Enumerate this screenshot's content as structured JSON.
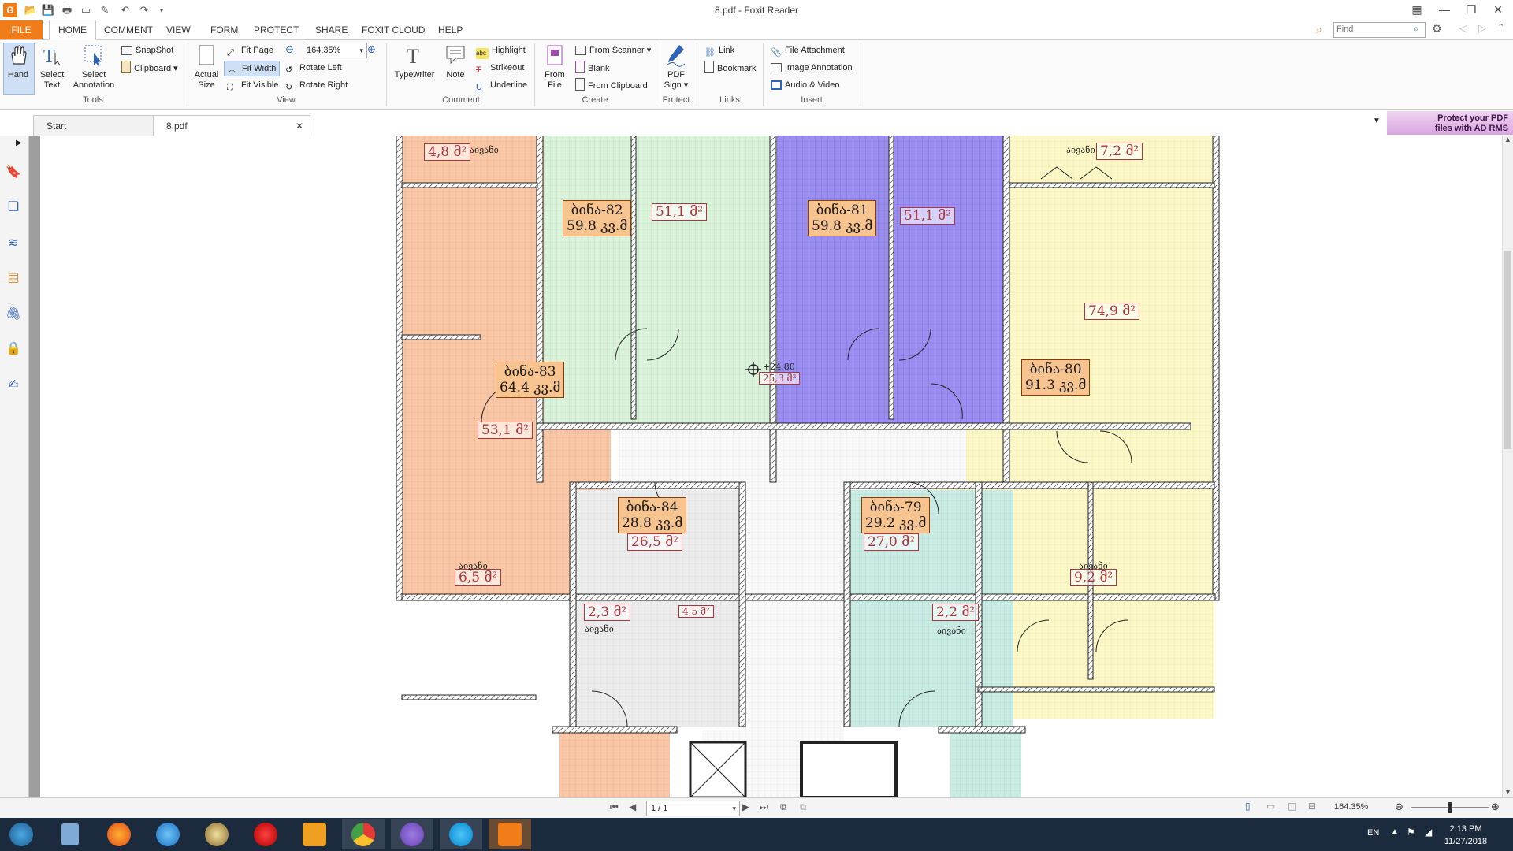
{
  "window": {
    "title": "8.pdf - Foxit Reader"
  },
  "ribbon_tabs": [
    "FILE",
    "HOME",
    "COMMENT",
    "VIEW",
    "FORM",
    "PROTECT",
    "SHARE",
    "FOXIT CLOUD",
    "HELP"
  ],
  "find_placeholder": "Find",
  "tools_group": {
    "label": "Tools",
    "hand": "Hand",
    "select_text_1": "Select",
    "select_text_2": "Text",
    "select_annot_1": "Select",
    "select_annot_2": "Annotation",
    "snapshot": "SnapShot",
    "clipboard": "Clipboard"
  },
  "view_group": {
    "label": "View",
    "actual_1": "Actual",
    "actual_2": "Size",
    "fit_page": "Fit Page",
    "fit_width": "Fit Width",
    "fit_visible": "Fit Visible",
    "zoom": "164.35%",
    "rotate_left": "Rotate Left",
    "rotate_right": "Rotate Right"
  },
  "comment_group": {
    "label": "Comment",
    "typewriter": "Typewriter",
    "note": "Note",
    "highlight": "Highlight",
    "strikeout": "Strikeout",
    "underline": "Underline"
  },
  "create_group": {
    "label": "Create",
    "from_file_1": "From",
    "from_file_2": "File",
    "from_scanner": "From Scanner",
    "blank": "Blank",
    "from_clipboard": "From Clipboard"
  },
  "protect_group": {
    "label": "Protect",
    "pdf_sign_1": "PDF",
    "pdf_sign_2": "Sign"
  },
  "links_group": {
    "label": "Links",
    "link": "Link",
    "bookmark": "Bookmark"
  },
  "insert_group": {
    "label": "Insert",
    "file_attachment": "File Attachment",
    "image_annotation": "Image Annotation",
    "audio_video": "Audio & Video"
  },
  "doc_tabs": [
    "Start",
    "8.pdf"
  ],
  "promo": {
    "line1": "Protect your PDF",
    "line2": "files with AD RMS"
  },
  "status": {
    "page": "1 / 1",
    "zoom": "164.35%"
  },
  "taskbar": {
    "lang": "EN",
    "time": "2:13 PM",
    "date": "11/27/2018"
  },
  "floorplan": {
    "rooms": [
      {
        "name": "ბინა-82",
        "area": "59.8  კვ.მ"
      },
      {
        "name": "ბინა-81",
        "area": "59.8  კვ.მ"
      },
      {
        "name": "ბინა-83",
        "area": "64.4  კვ.მ"
      },
      {
        "name": "ბინა-80",
        "area": "91.3  კვ.მ"
      },
      {
        "name": "ბინა-84",
        "area": "28.8  კვ.მ"
      },
      {
        "name": "ბინა-79",
        "area": "29.2  კვ.მ"
      }
    ],
    "areas": [
      "4,8  მ²",
      "7,2  მ²",
      "51,1  მ²",
      "51,1  მ²",
      "74,9  მ²",
      "53,1  მ²",
      "26,5  მ²",
      "27,0  მ²",
      "6,5  მ²",
      "9,2  მ²",
      "2,3  მ²",
      "2,2  მ²",
      "4,5  მ²",
      "25,3  მ²"
    ],
    "balcony": "აივანი",
    "elevation": "+24,80"
  }
}
